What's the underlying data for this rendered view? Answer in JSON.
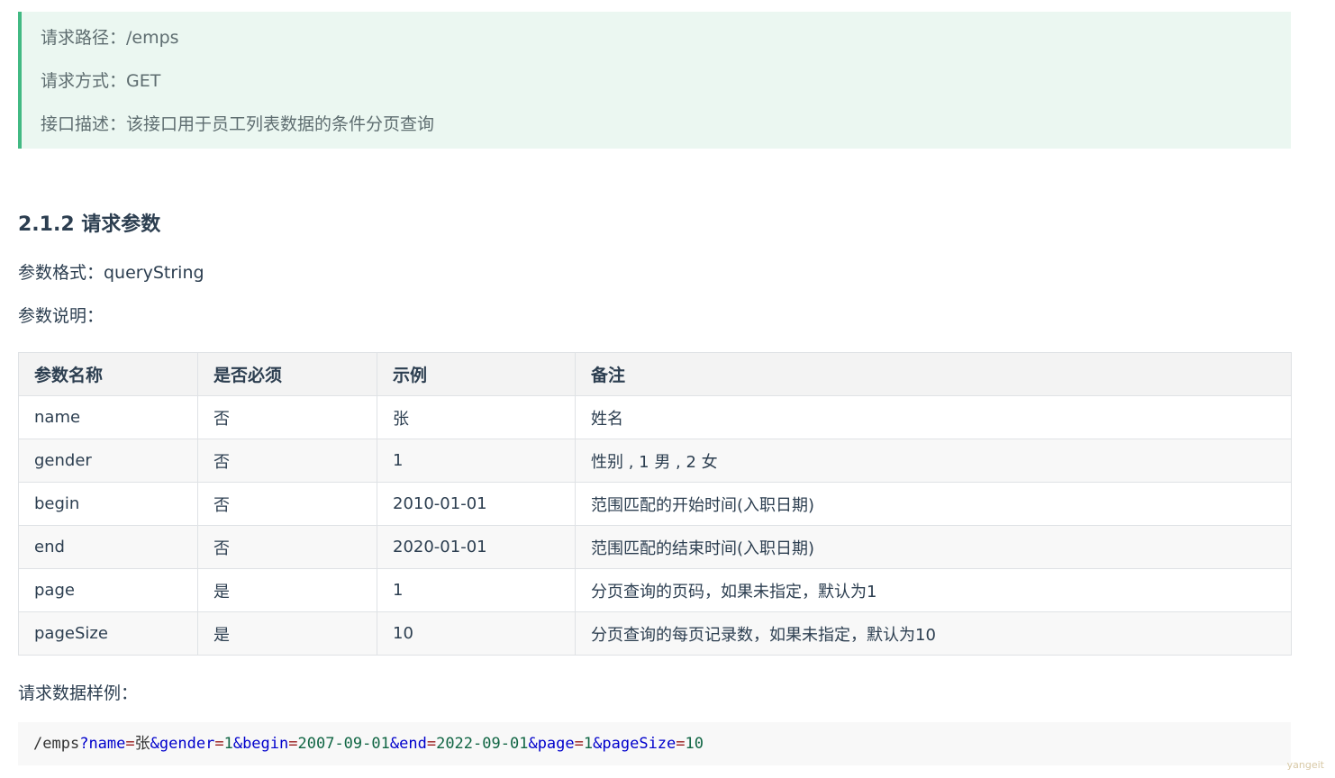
{
  "callout": {
    "line1": "请求路径：/emps",
    "line2": "请求方式：GET",
    "line3": "接口描述：该接口用于员工列表数据的条件分页查询"
  },
  "section": {
    "title": "2.1.2 请求参数",
    "format_line": "参数格式：queryString",
    "desc_line": "参数说明：",
    "sample_label": "请求数据样例："
  },
  "table": {
    "headers": [
      "参数名称",
      "是否必须",
      "示例",
      "备注"
    ],
    "rows": [
      [
        "name",
        "否",
        "张",
        "姓名"
      ],
      [
        "gender",
        "否",
        "1",
        "性别 , 1 男 , 2 女"
      ],
      [
        "begin",
        "否",
        "2010-01-01",
        "范围匹配的开始时间(入职日期)"
      ],
      [
        "end",
        "否",
        "2020-01-01",
        "范围匹配的结束时间(入职日期)"
      ],
      [
        "page",
        "是",
        "1",
        "分页查询的页码，如果未指定，默认为1"
      ],
      [
        "pageSize",
        "是",
        "10",
        "分页查询的每页记录数，如果未指定，默认为10"
      ]
    ]
  },
  "code": {
    "path": "/emps",
    "q": "?",
    "params": [
      {
        "sep": "",
        "key": "name",
        "value": "张"
      },
      {
        "sep": "&",
        "key": "gender",
        "value": "1"
      },
      {
        "sep": "&",
        "key": "begin",
        "value": "2007-09-01"
      },
      {
        "sep": "&",
        "key": "end",
        "value": "2022-09-01"
      },
      {
        "sep": "&",
        "key": "page",
        "value": "1"
      },
      {
        "sep": "&",
        "key": "pageSize",
        "value": "10"
      }
    ],
    "eq": "="
  },
  "watermark": "yangeit",
  "colors": {
    "accent": "#42b983",
    "callout_bg": "#ebf7f1",
    "code_key": "#0000cc",
    "code_value": "#116644"
  }
}
